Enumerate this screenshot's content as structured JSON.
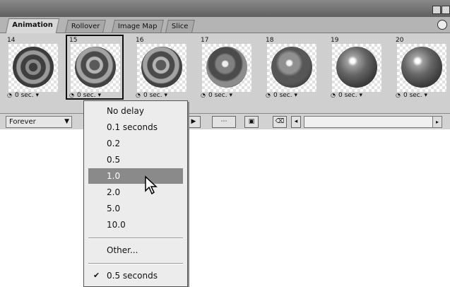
{
  "tabs": [
    "Animation",
    "Rollover",
    "Image Map",
    "Slice"
  ],
  "frames": [
    {
      "number": "14",
      "delay": "0 sec."
    },
    {
      "number": "15",
      "delay": "0 sec."
    },
    {
      "number": "16",
      "delay": "0 sec."
    },
    {
      "number": "17",
      "delay": "0 sec."
    },
    {
      "number": "18",
      "delay": "0 sec."
    },
    {
      "number": "19",
      "delay": "0 sec."
    },
    {
      "number": "20",
      "delay": "0 sec."
    }
  ],
  "loop_select": "Forever",
  "delay_menu": {
    "items": [
      "No delay",
      "0.1 seconds",
      "0.2",
      "0.5",
      "1.0",
      "2.0",
      "5.0",
      "10.0"
    ],
    "highlighted": "1.0",
    "other": "Other...",
    "current": "0.5 seconds"
  },
  "icons": [
    "frame-delay-clock-icon",
    "loop-dropdown-arrow-icon",
    "panel-menu-icon",
    "checkmark-icon",
    "mouse-pointer-icon"
  ]
}
